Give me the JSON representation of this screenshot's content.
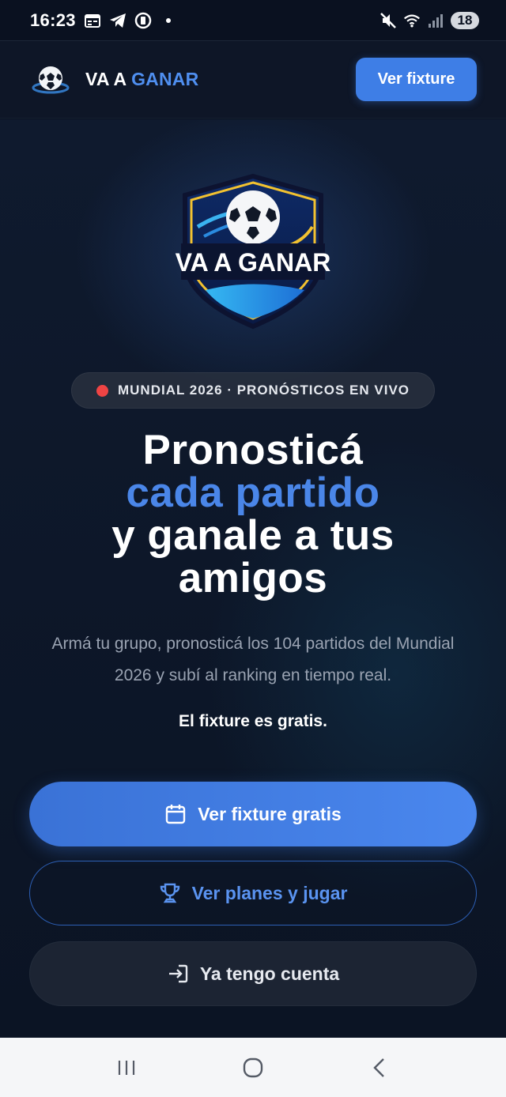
{
  "status_bar": {
    "time": "16:23",
    "battery": "18",
    "icons": [
      "calendar-icon",
      "telegram-icon",
      "notification-icon",
      "mute-icon",
      "wifi-icon",
      "signal-icon"
    ]
  },
  "header": {
    "brand_part1": "VA A",
    "brand_part2": "GANAR",
    "cta_label": "Ver fixture"
  },
  "hero": {
    "logo_text": "VA A GANAR",
    "badge_text": "MUNDIAL 2026 · PRONÓSTICOS EN VIVO",
    "headline_line1": "Pronosticá",
    "headline_line2": "cada partido",
    "headline_line3": "y ganale a tus",
    "headline_line4": "amigos",
    "subtitle": "Armá tu grupo, pronosticá los 104 partidos del Mundial 2026 y subí al ranking en tiempo real.",
    "free_note": "El fixture es gratis."
  },
  "actions": {
    "primary_label": "Ver fixture gratis",
    "secondary_label": "Ver planes y jugar",
    "tertiary_label": "Ya tengo cuenta"
  },
  "colors": {
    "accent": "#4a86e8",
    "background": "#0b1322",
    "live_dot": "#ef4444"
  }
}
